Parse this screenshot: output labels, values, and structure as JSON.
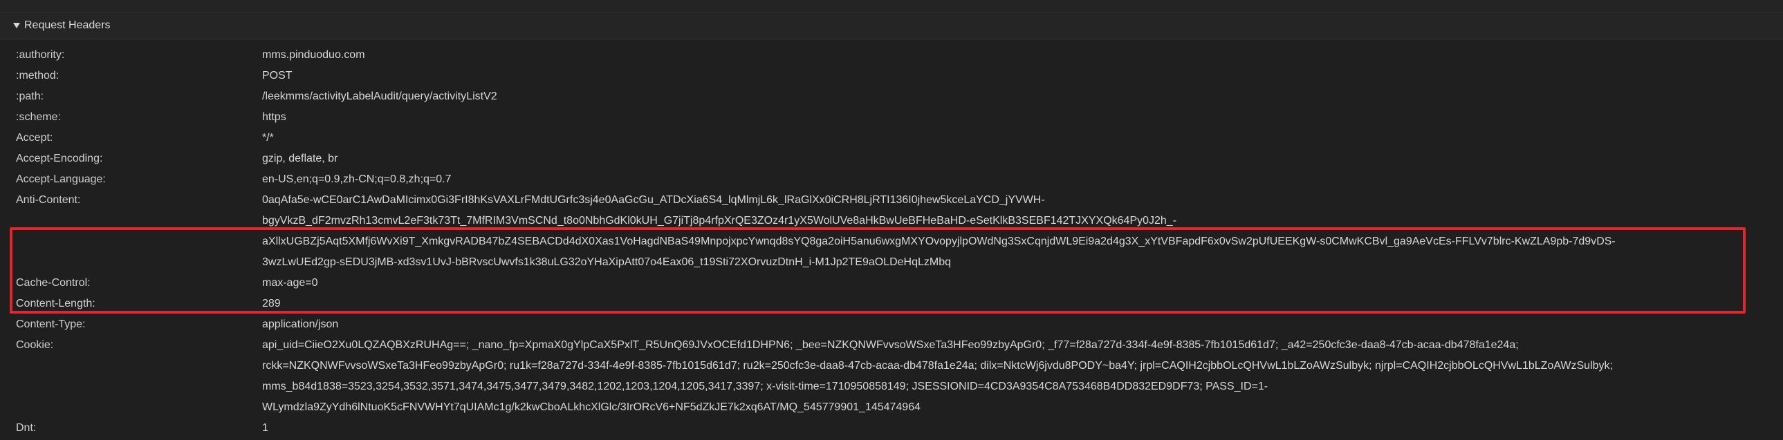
{
  "section": {
    "title": "Request Headers"
  },
  "headers": [
    {
      "name": ":authority:",
      "value_lines": [
        "mms.pinduoduo.com"
      ]
    },
    {
      "name": ":method:",
      "value_lines": [
        "POST"
      ]
    },
    {
      "name": ":path:",
      "value_lines": [
        "/leekmms/activityLabelAudit/query/activityListV2"
      ]
    },
    {
      "name": ":scheme:",
      "value_lines": [
        "https"
      ]
    },
    {
      "name": "Accept:",
      "value_lines": [
        "*/*"
      ]
    },
    {
      "name": "Accept-Encoding:",
      "value_lines": [
        "gzip, deflate, br"
      ]
    },
    {
      "name": "Accept-Language:",
      "value_lines": [
        "en-US,en;q=0.9,zh-CN;q=0.8,zh;q=0.7"
      ]
    },
    {
      "name": "Anti-Content:",
      "value_lines": [
        "0aqAfa5e-wCE0arC1AwDaMIcimx0Gi3FrI8hKsVAXLrFMdtUGrfc3sj4e0AaGcGu_ATDcXia6S4_lqMlmjL6k_lRaGlXx0iCRH8LjRTI136I0jhew5kceLaYCD_jYVWH-",
        "bgyVkzB_dF2mvzRh13cmvL2eF3tk73Tt_7MfRIM3VmSCNd_t8o0NbhGdKl0kUH_G7jiTj8p4rfpXrQE3ZOz4r1yX5WolUVe8aHkBwUeBFHeBaHD-eSetKlkB3SEBF142TJXYXQk64Py0J2h_-",
        "aXllxUGBZj5Aqt5XMfj6WvXi9T_XmkgvRADB47bZ4SEBACDd4dX0Xas1VoHagdNBaS49MnpojxpcYwnqd8sYQ8ga2oiH5anu6wxgMXYOvopyjlpOWdNg3SxCqnjdWL9Ei9a2d4g3X_xYtVBFapdF6x0vSw2pUfUEEKgW-s0CMwKCBvl_ga9AeVcEs-FFLVv7blrc-KwZLA9pb-7d9vDS-",
        "3wzLwUEd2gp-sEDU3jMB-xd3sv1UvJ-bBRvscUwvfs1k38uLG32oYHaXipAtt07o4Eax06_t19Sti72XOrvuzDtnH_i-M1Jp2TE9aOLDeHqLzMbq"
      ]
    },
    {
      "name": "Cache-Control:",
      "value_lines": [
        "max-age=0"
      ]
    },
    {
      "name": "Content-Length:",
      "value_lines": [
        "289"
      ]
    },
    {
      "name": "Content-Type:",
      "value_lines": [
        "application/json"
      ]
    },
    {
      "name": "Cookie:",
      "value_lines": [
        "api_uid=CiieO2Xu0LQZAQBXzRUHAg==; _nano_fp=XpmaX0gYlpCaX5PxlT_R5UnQ69JVxOCEfd1DHPN6; _bee=NZKQNWFvvsoWSxeTa3HFeo99zbyApGr0; _f77=f28a727d-334f-4e9f-8385-7fb1015d61d7; _a42=250cfc3e-daa8-47cb-acaa-db478fa1e24a;",
        "rckk=NZKQNWFvvsoWSxeTa3HFeo99zbyApGr0; ru1k=f28a727d-334f-4e9f-8385-7fb1015d61d7; ru2k=250cfc3e-daa8-47cb-acaa-db478fa1e24a; dilx=NktcWj6jvdu8PODY~ba4Y; jrpl=CAQIH2cjbbOLcQHVwL1bLZoAWzSulbyk; njrpl=CAQIH2cjbbOLcQHVwL1bLZoAWzSulbyk;",
        "mms_b84d1838=3523,3254,3532,3571,3474,3475,3477,3479,3482,1202,1203,1204,1205,3417,3397; x-visit-time=1710950858149; JSESSIONID=4CD3A9354C8A753468B4DD832ED9DF73; PASS_ID=1-",
        "WLymdzla9ZyYdh6lNtuoK5cFNVWHYt7qUIAMc1g/k2kwCboALkhcXlGlc/3IrORcV6+NF5dZkJE7k2xq6AT/MQ_545779901_145474964"
      ]
    },
    {
      "name": "Dnt:",
      "value_lines": [
        "1"
      ]
    }
  ]
}
